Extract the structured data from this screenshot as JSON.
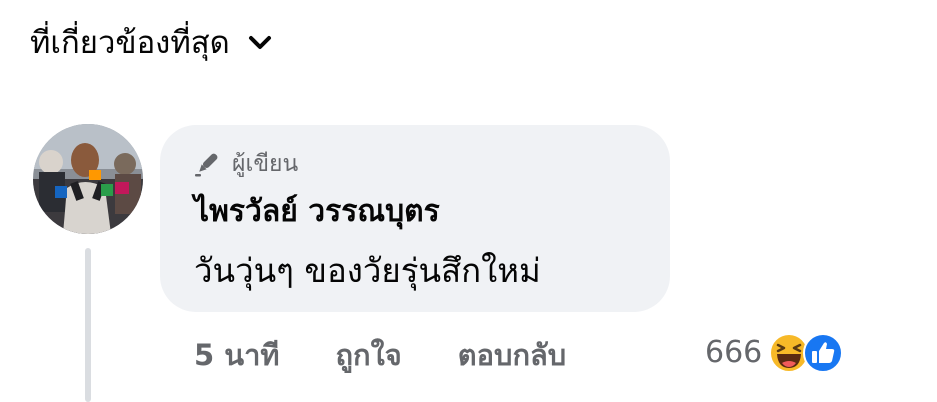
{
  "header": {
    "filter_label": "ที่เกี่ยวข้องที่สุด"
  },
  "comment": {
    "badge": "ผู้เขียน",
    "author": "ไพรวัลย์ วรรณบุตร",
    "text": "วันวุ่นๆ ของวัยรุ่นสึกใหม่",
    "timestamp": "5 นาที",
    "like_label": "ถูกใจ",
    "reply_label": "ตอบกลับ",
    "reaction_count": "666"
  },
  "colors": {
    "bubble_bg": "#f0f2f5",
    "secondary_text": "#65676b",
    "like_blue": "#1877f2",
    "haha_yellow": "#f7b928"
  },
  "icons": {
    "filter": "chevron-down-icon",
    "badge": "pen-icon",
    "reaction_1": "haha-emoji-icon",
    "reaction_2": "like-thumbs-up-icon"
  }
}
